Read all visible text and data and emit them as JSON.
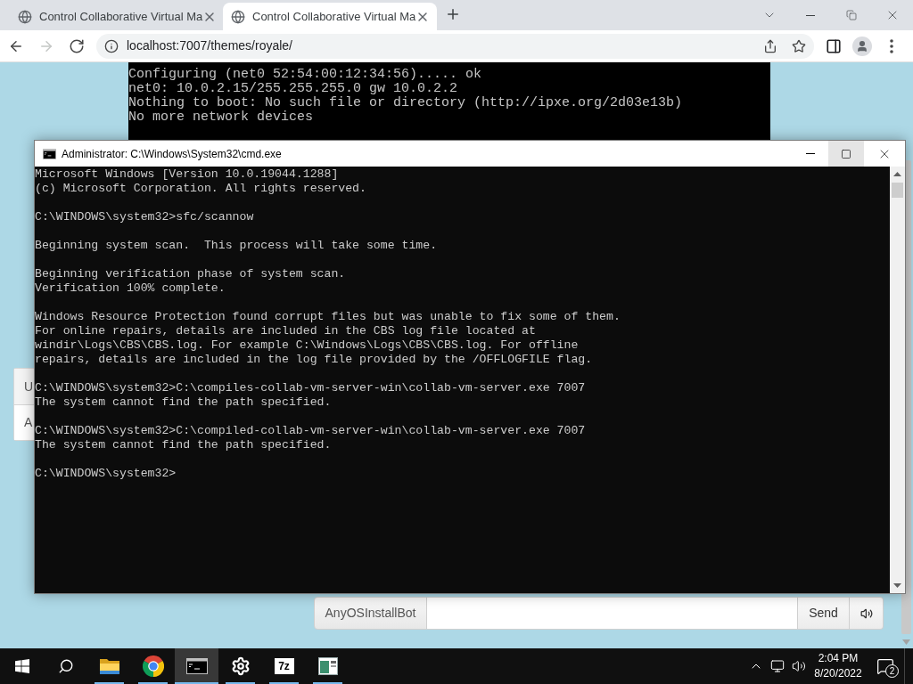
{
  "browser": {
    "tabs": [
      {
        "title": "Control Collaborative Virtual Ma",
        "selected": false
      },
      {
        "title": "Control Collaborative Virtual Ma",
        "selected": true
      }
    ],
    "toolbar": {
      "buttons": [
        {
          "kind": "back",
          "disabled": false
        },
        {
          "kind": "forward",
          "disabled": true
        },
        {
          "kind": "reload",
          "disabled": false
        }
      ],
      "url": "localhost:7007/themes/royale/"
    }
  },
  "vm_screen": {
    "lines": [
      "Configuring (net0 52:54:00:12:34:56)..... ok",
      "net0: 10.0.2.15/255.255.255.0 gw 10.0.2.2",
      "Nothing to boot: No such file or directory (http://ipxe.org/2d03e13b)",
      "No more network devices"
    ]
  },
  "user_list": {
    "items": [
      {
        "label": "U"
      },
      {
        "label": "A"
      }
    ]
  },
  "chat": {
    "username": "AnyOSInstallBot",
    "send_button": "Send"
  },
  "cmd_window": {
    "title": "Administrator: C:\\Windows\\System32\\cmd.exe",
    "buttons": [
      {
        "kind": "minimize",
        "hovered": false
      },
      {
        "kind": "maximize",
        "hovered": true
      },
      {
        "kind": "close",
        "hovered": false
      }
    ],
    "output": [
      {
        "lines": [
          "Microsoft Windows [Version 10.0.19044.1288]",
          "(c) Microsoft Corporation. All rights reserved."
        ]
      },
      {
        "lines": [
          "C:\\WINDOWS\\system32>sfc/scannow"
        ]
      },
      {
        "lines": [
          "Beginning system scan.  This process will take some time."
        ]
      },
      {
        "lines": [
          "Beginning verification phase of system scan.",
          "Verification 100% complete."
        ]
      },
      {
        "lines": [
          "Windows Resource Protection found corrupt files but was unable to fix some of them.",
          "For online repairs, details are included in the CBS log file located at",
          "windir\\Logs\\CBS\\CBS.log. For example C:\\Windows\\Logs\\CBS\\CBS.log. For offline",
          "repairs, details are included in the log file provided by the /OFFLOGFILE flag."
        ]
      },
      {
        "lines": [
          "C:\\WINDOWS\\system32>C:\\compiles-collab-vm-server-win\\collab-vm-server.exe 7007",
          "The system cannot find the path specified."
        ]
      },
      {
        "lines": [
          "C:\\WINDOWS\\system32>C:\\compiled-collab-vm-server-win\\collab-vm-server.exe 7007",
          "The system cannot find the path specified."
        ]
      },
      {
        "lines": [
          "C:\\WINDOWS\\system32>"
        ]
      }
    ]
  },
  "taskbar": {
    "apps": [
      {
        "kind": "folder",
        "running": true,
        "selected": false
      },
      {
        "kind": "browser",
        "running": true,
        "selected": false
      },
      {
        "kind": "terminal",
        "running": true,
        "selected": true
      },
      {
        "kind": "settings",
        "running": true,
        "selected": false
      },
      {
        "kind": "archiver",
        "label": "7z",
        "running": true,
        "selected": false
      },
      {
        "kind": "window",
        "running": true,
        "selected": false
      }
    ],
    "clock": {
      "time": "2:04 PM",
      "date": "8/20/2022"
    },
    "notification_count": "2"
  }
}
